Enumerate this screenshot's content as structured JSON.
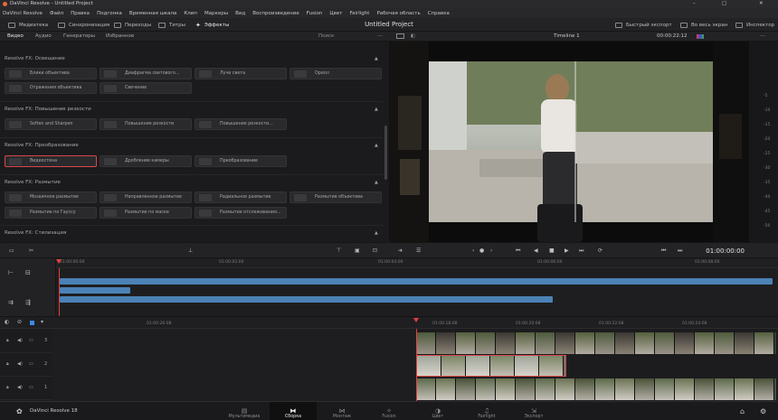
{
  "window": {
    "title": "DaVinci Resolve - Untitled Project",
    "controls": [
      "–",
      "□",
      "✕"
    ]
  },
  "menu": [
    "DaVinci Resolve",
    "Файл",
    "Правка",
    "Подгонка",
    "Временная шкала",
    "Клип",
    "Маркеры",
    "Вид",
    "Воспроизведение",
    "Fusion",
    "Цвет",
    "Fairlight",
    "Рабочая область",
    "Справка"
  ],
  "toolbar": {
    "media": "Медиатека",
    "sync": "Синхронизация",
    "transitions": "Переходы",
    "titles": "Титры",
    "effects": "Эффекты",
    "project_title": "Untitled Project",
    "quick_export": "Быстрый экспорт",
    "full_screen": "Во весь экран",
    "inspector": "Инспектор"
  },
  "effects_tabs": [
    "Видео",
    "Аудио",
    "Генераторы",
    "Избранное"
  ],
  "search_label": "Поиск",
  "categories": [
    {
      "title": "Resolve FX: Освещение",
      "tiles": [
        "Блики объектива",
        "Диафрагма светового...",
        "Лучи света",
        "Ореол",
        "Отражения объектива",
        "Свечение"
      ]
    },
    {
      "title": "Resolve FX: Повышение резкости",
      "tiles": [
        "Soften and Sharpen",
        "Повышение резкости",
        "Повышение резкости..."
      ]
    },
    {
      "title": "Resolve FX: Преобразование",
      "tiles": [
        "Видеостена",
        "Дробление камеры",
        "Преобразование"
      ]
    },
    {
      "title": "Resolve FX: Размытие",
      "tiles": [
        "Мозаичное размытие",
        "Направленное размытие",
        "Радиальное размытие",
        "Размытие объектива",
        "Размытие по Гауссу",
        "Размытие по маске",
        "Размытие отслеживания..."
      ]
    },
    {
      "title": "Resolve FX: Стилизация",
      "tiles": []
    }
  ],
  "viewer": {
    "timeline_name": "Timeline 1",
    "zoom": "00:00:22:12",
    "timecode": "01:00:00:00"
  },
  "vu_labels": [
    "-5",
    "-10",
    "-15",
    "-20",
    "-25",
    "-30",
    "-35",
    "-40",
    "-45",
    "-50"
  ],
  "upper_ruler": [
    "01:00:00:00",
    "01:00:02:00",
    "01:00:04:00",
    "01:00:06:00",
    "01:00:08:00"
  ],
  "lower_ruler": [
    "01:00:18:08",
    "01:00:20:08",
    "01:00:22:08",
    "01:00:24:08",
    "01:00:26:08"
  ],
  "tracks": [
    "3",
    "2",
    "1"
  ],
  "app_version": "DaVinci Resolve 18",
  "pages": [
    "Мультимедиа",
    "Сборка",
    "Монтаж",
    "Fusion",
    "Цвет",
    "Fairlight",
    "Экспорт"
  ],
  "active_page": "Сборка",
  "colors": {
    "accent_red": "#d8474b",
    "clip_blue": "#4b82b6",
    "playhead": "#e2403e"
  },
  "icons": {
    "media": "film-strip-icon",
    "effects": "magic-wand-icon",
    "home": "home-icon",
    "settings": "gear-icon"
  }
}
